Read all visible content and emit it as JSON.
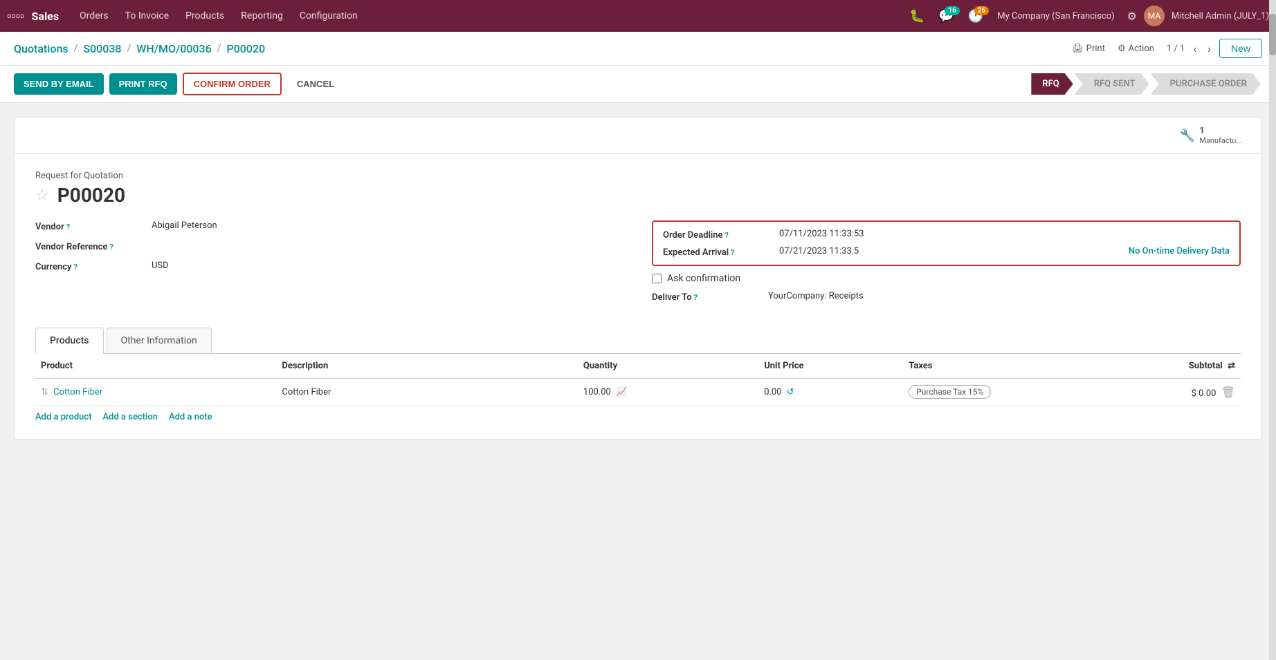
{
  "topnav": {
    "brand": "Sales",
    "nav_items": [
      "Orders",
      "To Invoice",
      "Products",
      "Reporting",
      "Configuration"
    ],
    "badge_messages": "16",
    "badge_activity": "26",
    "company": "My Company (San Francisco)",
    "user": "Mitchell Admin (JULY_1)"
  },
  "breadcrumb": {
    "parts": [
      "Quotations",
      "S00038",
      "WH/MO/00036",
      "P00020"
    ],
    "print": "Print",
    "action": "Action",
    "pagination": "1 / 1",
    "new_btn": "New"
  },
  "actionbar": {
    "send_email": "SEND BY EMAIL",
    "print_rfq": "PRINT RFQ",
    "confirm_order": "CONFIRM ORDER",
    "cancel": "CANCEL"
  },
  "pipeline": {
    "steps": [
      "RFQ",
      "RFQ SENT",
      "PURCHASE ORDER"
    ],
    "active": 0
  },
  "smart_buttons": {
    "manufacture_count": "1",
    "manufacture_label": "Manufactu..."
  },
  "form": {
    "subtitle": "Request for Quotation",
    "doc_id": "P00020",
    "vendor_label": "Vendor",
    "vendor_value": "Abigail Peterson",
    "vendor_ref_label": "Vendor Reference",
    "vendor_ref_value": "",
    "currency_label": "Currency",
    "currency_value": "USD",
    "order_deadline_label": "Order Deadline",
    "order_deadline_value": "07/11/2023 11:33:53",
    "expected_arrival_label": "Expected Arrival",
    "expected_arrival_value": "07/21/2023 11:33:5",
    "no_delivery": "No On-time Delivery Data",
    "ask_confirmation_label": "Ask confirmation",
    "deliver_to_label": "Deliver To",
    "deliver_to_value": "YourCompany: Receipts"
  },
  "tabs": {
    "items": [
      "Products",
      "Other Information"
    ],
    "active": 0
  },
  "table": {
    "headers": [
      "Product",
      "Description",
      "Quantity",
      "Unit Price",
      "Taxes",
      "Subtotal"
    ],
    "rows": [
      {
        "product": "Cotton Fiber",
        "description": "Cotton Fiber",
        "quantity": "100.00",
        "unit_price": "0.00",
        "tax": "Purchase Tax 15%",
        "subtotal": "$ 0.00"
      }
    ],
    "add_product": "Add a product",
    "add_section": "Add a section",
    "add_note": "Add a note"
  }
}
